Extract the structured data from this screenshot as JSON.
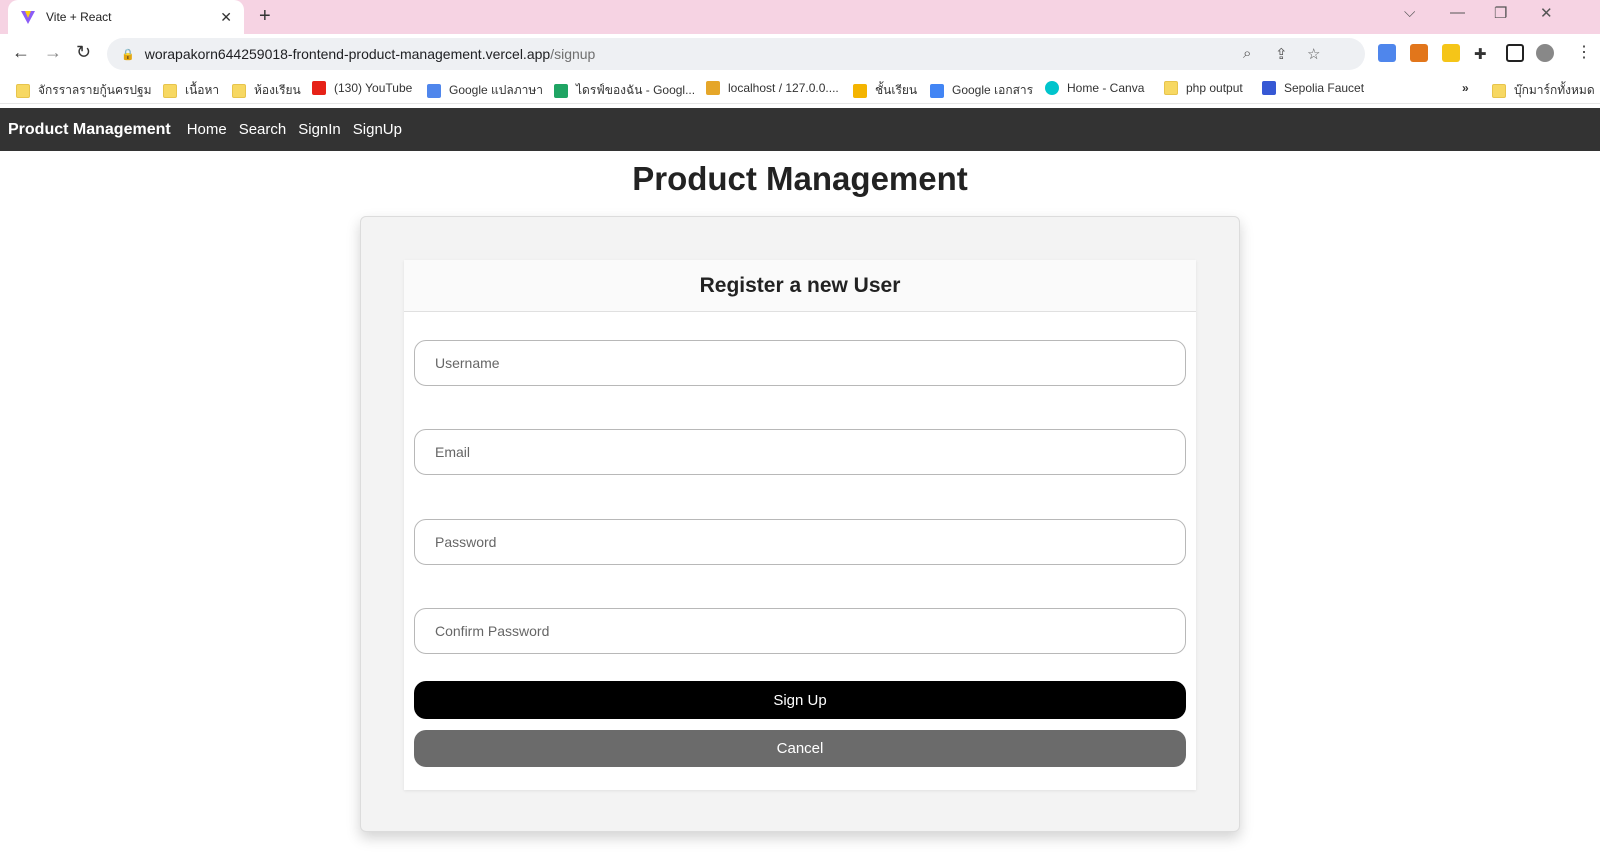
{
  "browser": {
    "tab_title": "Vite + React",
    "url_host": "worapakorn644259018-frontend-product-management.vercel.app",
    "url_path": "/signup",
    "bookmarks": [
      {
        "label": "จักรราลรายกู้นครปฐม",
        "icon": "folder-icon"
      },
      {
        "label": "เนื้อหา",
        "icon": "folder-icon"
      },
      {
        "label": "ห้องเรียน",
        "icon": "folder-icon"
      },
      {
        "label": "(130) YouTube",
        "icon": "youtube-icon"
      },
      {
        "label": "Google แปลภาษา",
        "icon": "translate-icon"
      },
      {
        "label": "ไดรฟ์ของฉัน - Googl...",
        "icon": "drive-icon"
      },
      {
        "label": "localhost / 127.0.0....",
        "icon": "phpmyadmin-icon"
      },
      {
        "label": "ชั้นเรียน",
        "icon": "classroom-icon"
      },
      {
        "label": "Google เอกสาร",
        "icon": "docs-icon"
      },
      {
        "label": "Home - Canva",
        "icon": "canva-icon"
      },
      {
        "label": "php output",
        "icon": "folder-icon"
      },
      {
        "label": "Sepolia Faucet",
        "icon": "alchemy-icon"
      }
    ],
    "other_bookmarks": "บุ๊กมาร์กทั้งหมด",
    "more": "»"
  },
  "navbar": {
    "brand": "Product Management",
    "links": [
      "Home",
      "Search",
      "SignIn",
      "SignUp"
    ]
  },
  "page": {
    "title": "Product Management",
    "form_title": "Register a new User",
    "fields": {
      "username": "Username",
      "email": "Email",
      "password": "Password",
      "confirm_password": "Confirm Password"
    },
    "submit_label": "Sign Up",
    "cancel_label": "Cancel"
  }
}
